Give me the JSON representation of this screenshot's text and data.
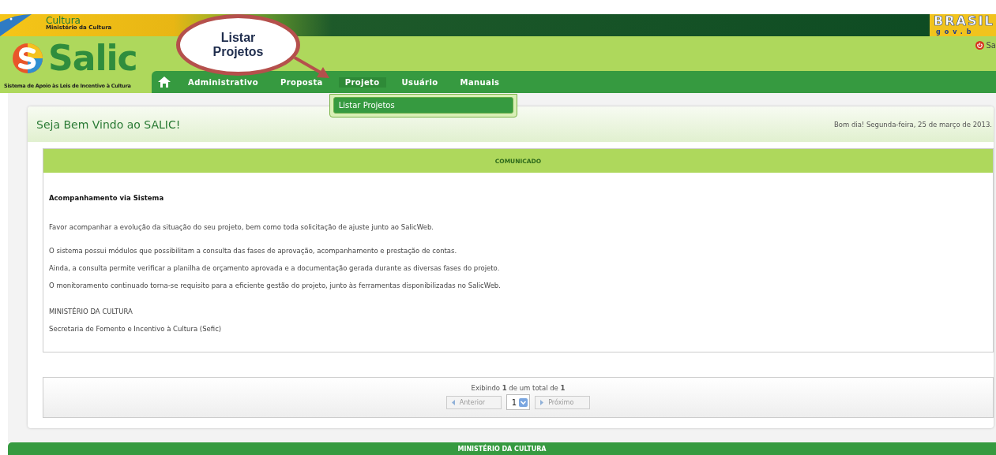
{
  "header": {
    "ministry_name": "Cultura",
    "ministry_subtitle": "Ministério da Cultura",
    "brand": "BRASIL",
    "brand_sub": "gov.b",
    "logo_text": "Salic",
    "logo_tagline": "Sistema de Apoio às Leis de Incentivo à Cultura",
    "logout_label": "Sa"
  },
  "nav": {
    "items": [
      {
        "label": "Administrativo",
        "expanded": false
      },
      {
        "label": "Proposta",
        "expanded": false
      },
      {
        "label": "Projeto",
        "expanded": true,
        "menu": [
          {
            "label": "Listar Projetos",
            "selected": true
          }
        ]
      },
      {
        "label": "Usuário",
        "expanded": false
      },
      {
        "label": "Manuais",
        "expanded": false
      }
    ]
  },
  "callout": {
    "text": "Listar Projetos"
  },
  "welcome": {
    "title": "Seja Bem Vindo ao SALIC!",
    "greeting": "Bom dia! Segunda-feira, 25 de março de 2013."
  },
  "notice": {
    "header": "COMUNICADO",
    "heading": "Acompanhamento via Sistema",
    "paragraphs": [
      "Favor acompanhar a evolução da situação do seu projeto, bem como toda solicitação de ajuste junto ao SalicWeb.",
      "O sistema possui módulos que possibilitam a consulta das fases de aprovação, acompanhamento e prestação de contas.",
      "Ainda, a consulta permite verificar a planilha de orçamento aprovada e a documentação gerada durante as diversas fases do projeto.",
      "O monitoramento continuado torna-se requisito para a eficiente gestão do projeto, junto às ferramentas disponibilizadas no SalicWeb."
    ],
    "signature": [
      "MINISTÉRIO DA CULTURA",
      "Secretaria de Fomento e Incentivo à Cultura (Sefic)"
    ]
  },
  "pager": {
    "summary": "Exibindo **1** de um total de **1**",
    "previous": "Anterior",
    "page": "1",
    "next": "Próximo"
  },
  "footer": {
    "text": "MINISTÉRIO DA CULTURA"
  }
}
